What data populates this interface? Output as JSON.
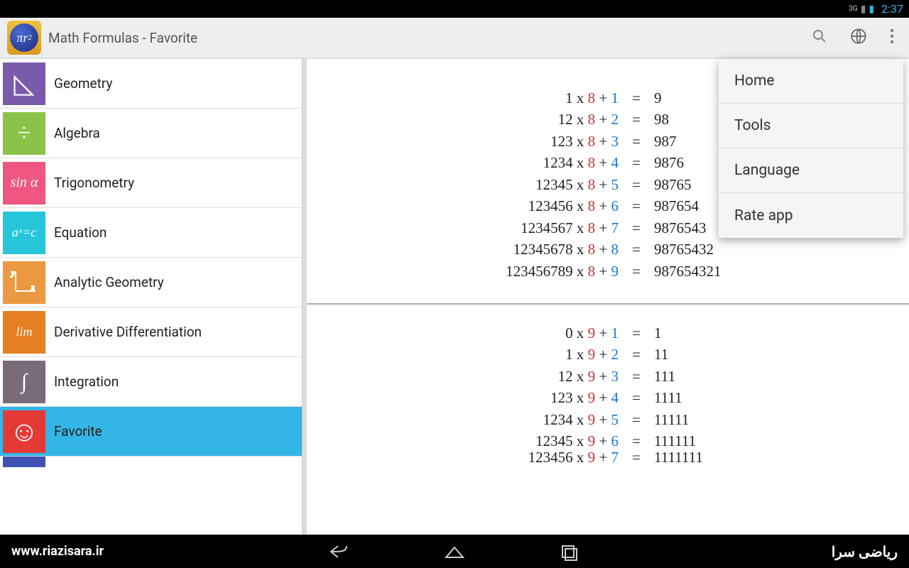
{
  "status": {
    "network_label": "3G",
    "time": "2:37"
  },
  "header": {
    "title": "Math Formulas - Favorite"
  },
  "sidebar": {
    "items": [
      {
        "label": "Geometry",
        "icon_class": "geom",
        "glyph": "◺"
      },
      {
        "label": "Algebra",
        "icon_class": "alg",
        "glyph": "÷"
      },
      {
        "label": "Trigonometry",
        "icon_class": "trig",
        "glyph": "sin α"
      },
      {
        "label": "Equation",
        "icon_class": "eq",
        "glyph": "aˣ=c"
      },
      {
        "label": "Analytic Geometry",
        "icon_class": "ana",
        "glyph": "↯"
      },
      {
        "label": "Derivative Differentiation",
        "icon_class": "der",
        "glyph": "lim"
      },
      {
        "label": "Integration",
        "icon_class": "int",
        "glyph": "∫"
      },
      {
        "label": "Favorite",
        "icon_class": "fav",
        "glyph": "☺",
        "selected": true
      }
    ]
  },
  "menu": {
    "items": [
      {
        "label": "Home"
      },
      {
        "label": "Tools"
      },
      {
        "label": "Language"
      },
      {
        "label": "Rate app"
      }
    ]
  },
  "formulas": {
    "block1": {
      "mult": "8",
      "rows": [
        {
          "a": "1",
          "b": "1",
          "r": "9"
        },
        {
          "a": "12",
          "b": "2",
          "r": "98"
        },
        {
          "a": "123",
          "b": "3",
          "r": "987"
        },
        {
          "a": "1234",
          "b": "4",
          "r": "9876"
        },
        {
          "a": "12345",
          "b": "5",
          "r": "98765"
        },
        {
          "a": "123456",
          "b": "6",
          "r": "987654"
        },
        {
          "a": "1234567",
          "b": "7",
          "r": "9876543"
        },
        {
          "a": "12345678",
          "b": "8",
          "r": "98765432"
        },
        {
          "a": "123456789",
          "b": "9",
          "r": "987654321"
        }
      ]
    },
    "block2": {
      "mult": "9",
      "rows": [
        {
          "a": "0",
          "b": "1",
          "r": "1"
        },
        {
          "a": "1",
          "b": "2",
          "r": "11"
        },
        {
          "a": "12",
          "b": "3",
          "r": "111"
        },
        {
          "a": "123",
          "b": "4",
          "r": "1111"
        },
        {
          "a": "1234",
          "b": "5",
          "r": "11111"
        },
        {
          "a": "12345",
          "b": "6",
          "r": "111111"
        },
        {
          "a": "123456",
          "b": "7",
          "r": "1111111"
        }
      ]
    }
  },
  "footer": {
    "left": "www.riazisara.ir",
    "right": "ریاضی سرا"
  }
}
